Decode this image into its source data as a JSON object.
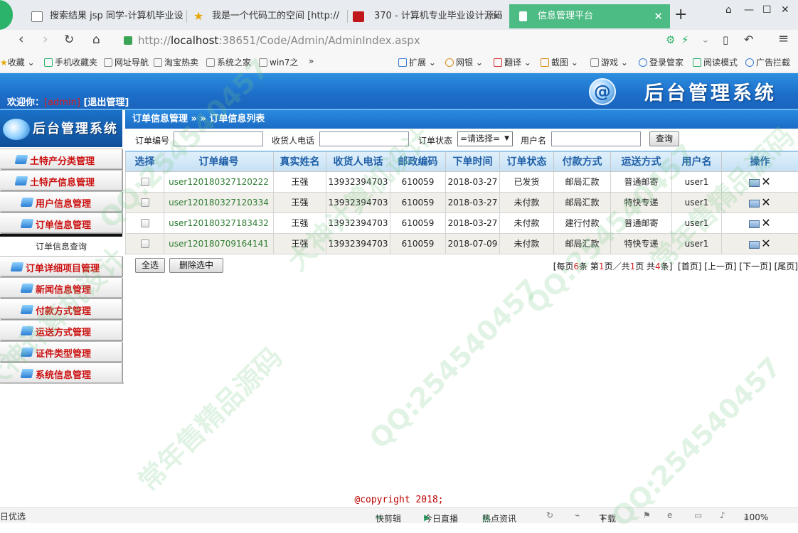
{
  "browser": {
    "tabs": [
      {
        "title": "搜索结果 jsp 同学-计算机毕业设",
        "icon": "doc-icon",
        "active": false
      },
      {
        "title": "我是一个代码工的空间 [http://",
        "icon": "star-icon",
        "active": false
      },
      {
        "title": "370 - 计算机专业毕业设计源码",
        "icon": "red-square-icon",
        "active": false
      },
      {
        "title": "信息管理平台",
        "icon": "page-icon",
        "active": true
      }
    ],
    "url_prefix": "http://",
    "url_host": "localhost",
    "url_rest": ":38651/Code/Admin/AdminIndex.aspx",
    "bookmarks": [
      "收藏",
      "手机收藏夹",
      "网址导航",
      "淘宝热卖",
      "系统之家",
      "win7之",
      "»",
      "扩展",
      "网银",
      "翻译",
      "截图",
      "游戏",
      "登录管家",
      "阅读模式",
      "广告拦截"
    ]
  },
  "header": {
    "welcome": "欢迎你：",
    "user": "[admin]",
    "logout": "[退出管理]",
    "brand": "后台管理系统",
    "brand_mark": "@"
  },
  "sidebar": {
    "brand": "后台管理系统",
    "items": [
      {
        "label": "土特产分类管理",
        "dark": false
      },
      {
        "label": "土特产信息管理",
        "dark": false
      },
      {
        "label": "用户信息管理",
        "dark": false
      },
      {
        "label": "订单信息管理",
        "dark": false
      },
      {
        "label": "订单详细项目管理",
        "dark": false
      },
      {
        "label": "新闻信息管理",
        "dark": false
      },
      {
        "label": "付款方式管理",
        "dark": false
      },
      {
        "label": "运送方式管理",
        "dark": false
      },
      {
        "label": "证件类型管理",
        "dark": false
      },
      {
        "label": "系统信息管理",
        "dark": false
      }
    ],
    "subitem": "订单信息查询"
  },
  "breadcrumb": "订单信息管理 » » 订单信息列表",
  "search": {
    "order_no_label": "订单编号",
    "phone_label": "收货人电话",
    "status_label": "订单状态",
    "status_value": "=请选择=",
    "username_label": "用户名",
    "query_button": "查询"
  },
  "table": {
    "headers": [
      "选择",
      "订单编号",
      "真实姓名",
      "收货人电话",
      "邮政编码",
      "下单时间",
      "订单状态",
      "付款方式",
      "运送方式",
      "用户名",
      "操作"
    ],
    "rows": [
      [
        "user120180327120222",
        "王强",
        "13932394703",
        "610059",
        "2018-03-27",
        "已发货",
        "邮局汇款",
        "普通邮寄",
        "user1"
      ],
      [
        "user120180327120334",
        "王强",
        "13932394703",
        "610059",
        "2018-03-27",
        "未付款",
        "邮局汇款",
        "特快专递",
        "user1"
      ],
      [
        "user120180327183432",
        "王强",
        "13932394703",
        "610059",
        "2018-03-27",
        "未付款",
        "建行付款",
        "普通邮寄",
        "user1"
      ],
      [
        "user120180709164141",
        "王强",
        "13932394703",
        "610059",
        "2018-07-09",
        "未付款",
        "邮局汇款",
        "特快专递",
        "user1"
      ]
    ]
  },
  "actions": {
    "select_all": "全选",
    "delete_selected": "删除选中"
  },
  "pager": {
    "p1": "[每页",
    "per_page": "6",
    "p2": "条 第",
    "page": "1",
    "p3": "页／共",
    "pages": "1",
    "p4": "页 共",
    "total": "4",
    "p5": "条]",
    "first": "[首页]",
    "prev": "[上一页]",
    "next": "[下一页]",
    "last": "[尾页]"
  },
  "copyright": "@copyright 2018;",
  "statusbar": [
    "日优选",
    "快剪辑",
    "今日直播",
    "热点资讯",
    "下载",
    "100%"
  ],
  "watermark": [
    "QQ:254540457",
    "大神计算机设计",
    "常年售精品源码"
  ]
}
